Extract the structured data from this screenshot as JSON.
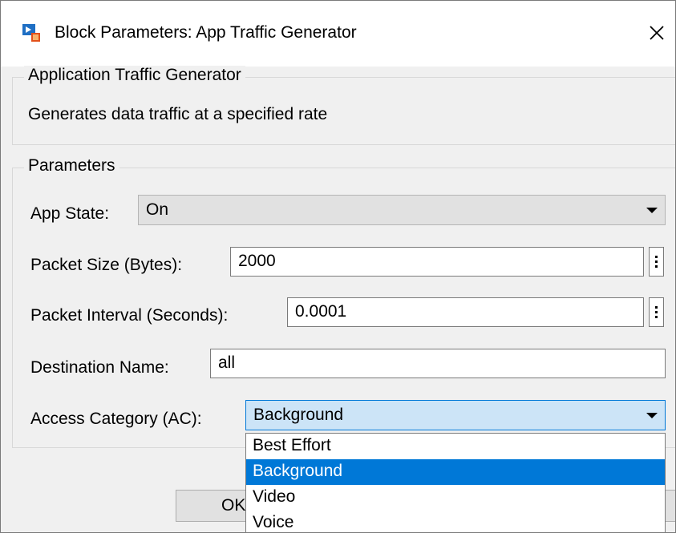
{
  "window": {
    "title": "Block Parameters: App Traffic Generator",
    "title_icon": "simulink-block-icon",
    "close_icon": "close-icon"
  },
  "description_group": {
    "legend": "Application Traffic Generator",
    "text": "Generates data traffic at a specified rate"
  },
  "parameters_group": {
    "legend": "Parameters",
    "app_state": {
      "label": "App State:",
      "value": "On"
    },
    "packet_size": {
      "label": "Packet Size (Bytes):",
      "value": "2000"
    },
    "packet_interval": {
      "label": "Packet Interval (Seconds):",
      "value": "0.0001"
    },
    "destination_name": {
      "label": "Destination Name:",
      "value": "all"
    },
    "access_category": {
      "label": "Access Category (AC):",
      "value": "Background",
      "options": [
        "Best Effort",
        "Background",
        "Video",
        "Voice"
      ],
      "selected_index": 1
    }
  },
  "buttons": {
    "ok_label": "OK"
  },
  "colors": {
    "accent": "#0078d7",
    "dialog_bg": "#f0f0f0",
    "combo_focus_bg": "#cce4f7"
  }
}
